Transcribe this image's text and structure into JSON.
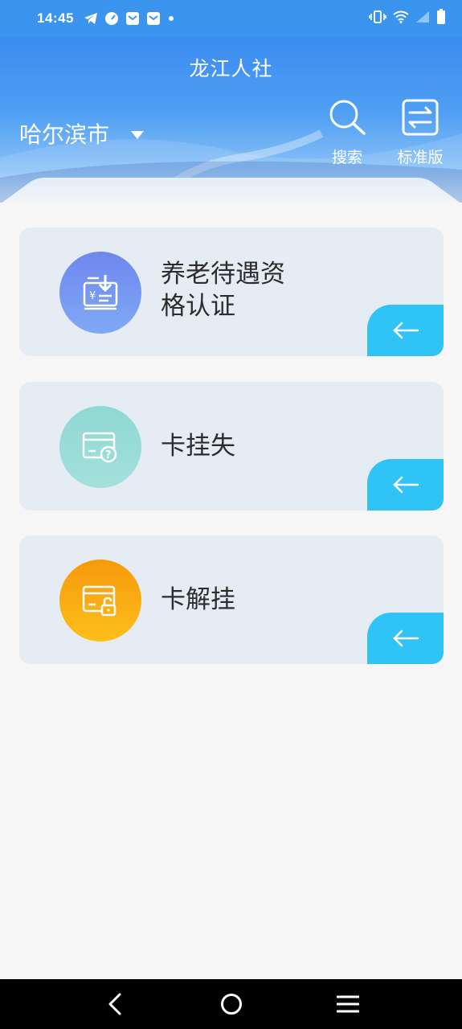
{
  "status_bar": {
    "time": "14:45",
    "left_icons": [
      "telegram-icon",
      "speedometer-icon",
      "mail-icon",
      "mail-icon",
      "dot-icon"
    ],
    "right_icons": [
      "vibrate-icon",
      "wifi-icon",
      "signal-icon",
      "battery-icon"
    ]
  },
  "header": {
    "title": "龙江人社",
    "city": "哈尔滨市",
    "search_label": "搜索",
    "standard_label": "标准版"
  },
  "cards": [
    {
      "title_line1": "养老待遇资",
      "title_line2": "格认证",
      "icon": "pension-download-icon",
      "color_top": "#6f87ee",
      "color_bottom": "#7fa9f6"
    },
    {
      "title": "卡挂失",
      "icon": "card-question-icon",
      "color_top": "#8fd8d3",
      "color_bottom": "#a3e0dc"
    },
    {
      "title": "卡解挂",
      "icon": "card-unlock-icon",
      "color_top": "#f69a0c",
      "color_bottom": "#fdbf1a"
    }
  ],
  "colors": {
    "header_blue": "#3b8cf0",
    "card_bg": "#e6ecf3",
    "arrow_bg": "#2fc3f6"
  }
}
